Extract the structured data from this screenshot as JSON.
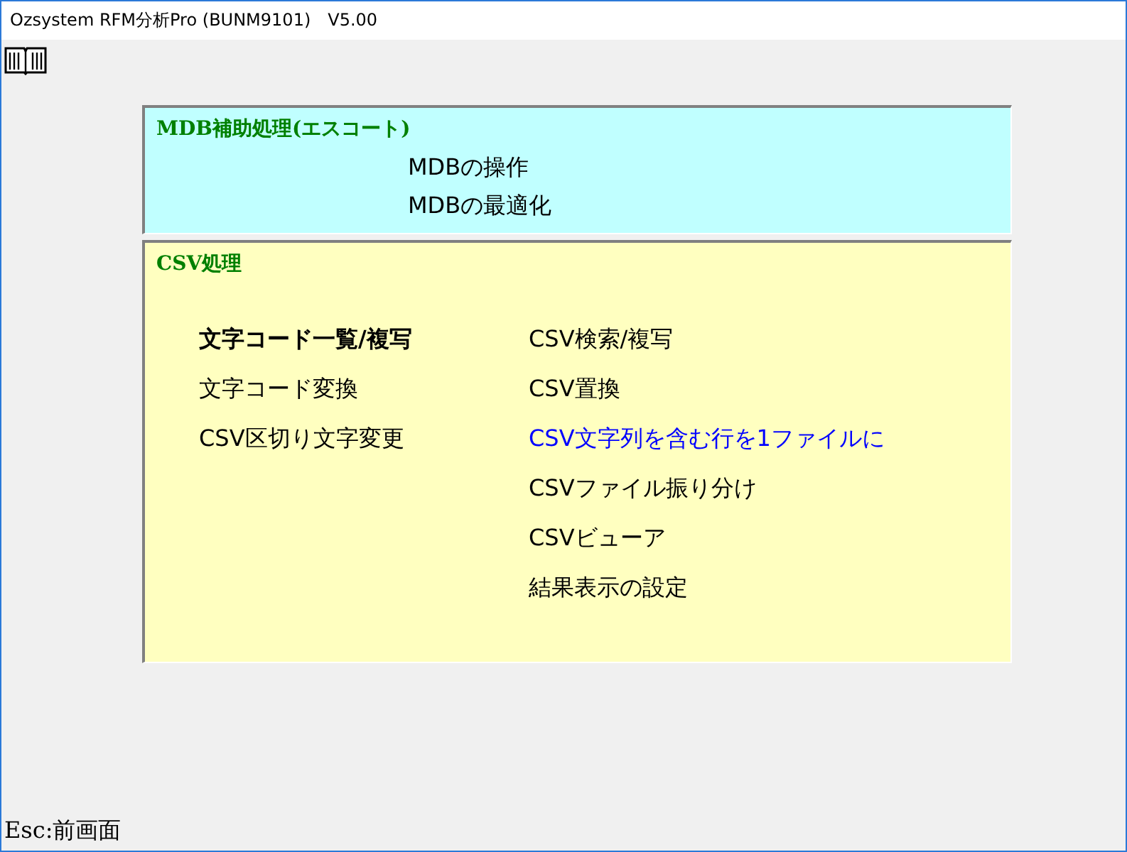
{
  "window": {
    "title": "Ozsystem RFM分析Pro (BUNM9101)　V5.00"
  },
  "sections": [
    {
      "title": "MDB補助処理(エスコート)",
      "kind": "mdb",
      "columns": [
        [
          {
            "label": "MDBの操作",
            "selected": false,
            "hovered": false
          },
          {
            "label": "MDBの最適化",
            "selected": false,
            "hovered": false
          }
        ]
      ]
    },
    {
      "title": "CSV処理",
      "kind": "csv",
      "columns": [
        [
          {
            "label": "文字コード一覧/複写",
            "selected": true,
            "hovered": false
          },
          {
            "label": "文字コード変換",
            "selected": false,
            "hovered": false
          },
          {
            "label": "CSV区切り文字変更",
            "selected": false,
            "hovered": false
          }
        ],
        [
          {
            "label": "CSV検索/複写",
            "selected": false,
            "hovered": false
          },
          {
            "label": "CSV置換",
            "selected": false,
            "hovered": false
          },
          {
            "label": "CSV文字列を含む行を1ファイルに",
            "selected": false,
            "hovered": true
          },
          {
            "label": "CSVファイル振り分け",
            "selected": false,
            "hovered": false
          },
          {
            "label": "CSVビューア",
            "selected": false,
            "hovered": false
          },
          {
            "label": "結果表示の設定",
            "selected": false,
            "hovered": false
          }
        ]
      ]
    }
  ],
  "status_bar": {
    "hint": "Esc:前画面"
  }
}
